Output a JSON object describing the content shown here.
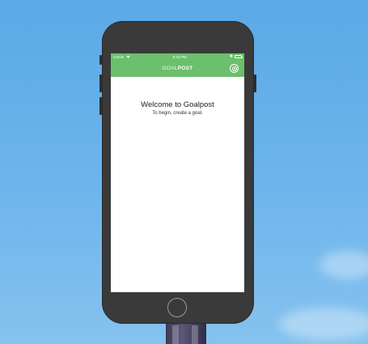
{
  "status_bar": {
    "carrier": "Carrier",
    "time": "5:16 PM",
    "wifi_icon": "wifi-icon",
    "battery_icon": "battery-icon"
  },
  "nav": {
    "brand_light": "GOAL",
    "brand_bold": "POST",
    "add_button_icon": "add-goal-icon",
    "color": "#6cbf6c"
  },
  "welcome": {
    "title": "Welcome to Goalpost",
    "subtitle": "To begin, create a goal."
  }
}
